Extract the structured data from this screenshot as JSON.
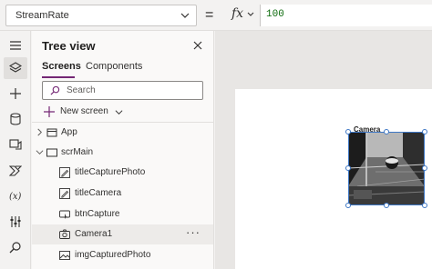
{
  "formula_bar": {
    "property": "StreamRate",
    "equals": "=",
    "fx_label": "fx",
    "formula": "100"
  },
  "rail": {
    "items": [
      {
        "name": "hamburger-menu-icon"
      },
      {
        "name": "layers-icon",
        "active": true
      },
      {
        "name": "insert-plus-icon"
      },
      {
        "name": "data-cylinder-icon"
      },
      {
        "name": "media-icon"
      },
      {
        "name": "power-automate-icon"
      },
      {
        "name": "variables-icon"
      },
      {
        "name": "advanced-tools-icon"
      },
      {
        "name": "search-icon"
      }
    ]
  },
  "tree_view": {
    "title": "Tree view",
    "tabs": [
      "Screens",
      "Components"
    ],
    "active_tab": "Screens",
    "search_placeholder": "Search",
    "new_screen_label": "New screen",
    "items": [
      {
        "label": "App",
        "icon": "app-icon",
        "level": 0,
        "expander": "right"
      },
      {
        "label": "scrMain",
        "icon": "screen-icon",
        "level": 0,
        "expander": "down"
      },
      {
        "label": "titleCapturePhoto",
        "icon": "label-edit-icon",
        "level": 1
      },
      {
        "label": "titleCamera",
        "icon": "label-edit-icon",
        "level": 1
      },
      {
        "label": "btnCapture",
        "icon": "button-icon",
        "level": 1
      },
      {
        "label": "Camera1",
        "icon": "camera-icon",
        "level": 1,
        "selected": true,
        "more": "···"
      },
      {
        "label": "imgCapturedPhoto",
        "icon": "image-icon",
        "level": 1
      }
    ]
  },
  "canvas": {
    "camera_label": "Camera"
  },
  "colors": {
    "accent": "#742774",
    "selection": "#3e77c5",
    "formula_text": "#0b6a0b"
  }
}
